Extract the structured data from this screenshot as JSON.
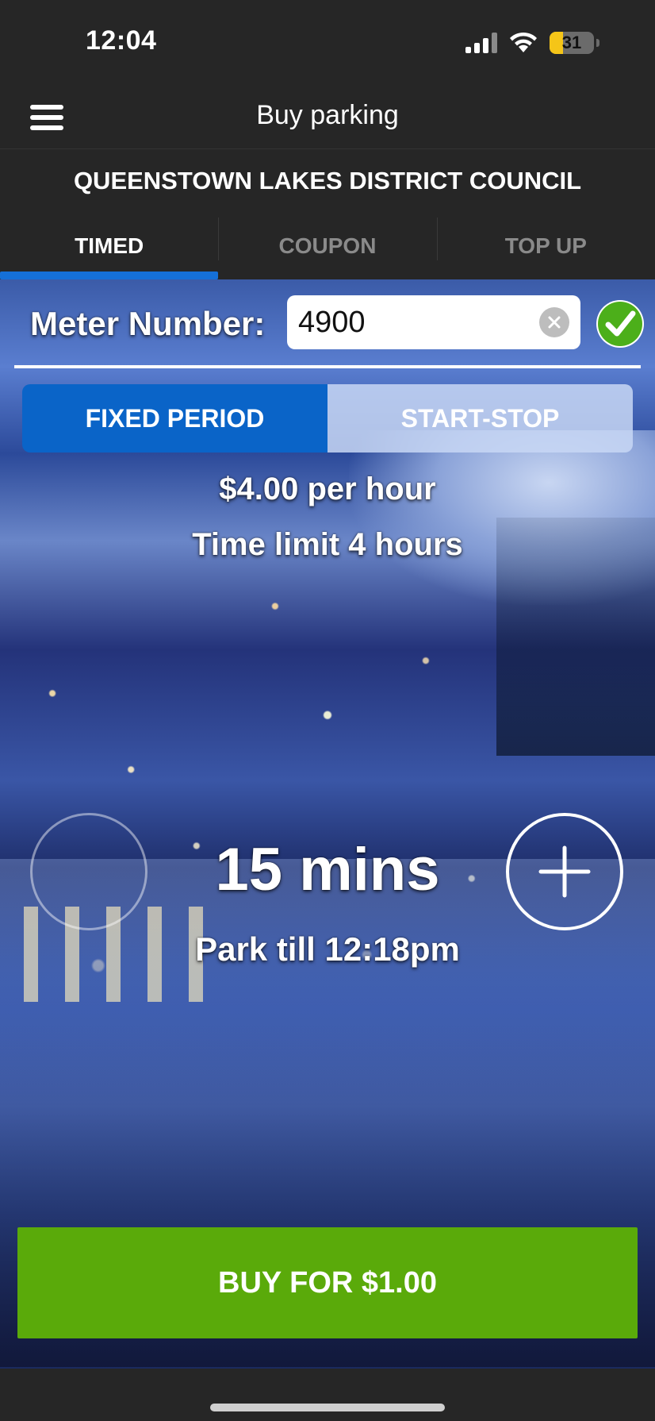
{
  "status_bar": {
    "time": "12:04",
    "battery_level": "31",
    "battery_fraction": 0.31,
    "signal_icon": "cellular-signal-icon",
    "wifi_icon": "wifi-icon"
  },
  "header": {
    "title": "Buy parking",
    "menu_icon": "hamburger-menu-icon"
  },
  "council": "QUEENSTOWN LAKES DISTRICT COUNCIL",
  "tabs": [
    {
      "label": "TIMED",
      "active": true
    },
    {
      "label": "COUPON",
      "active": false
    },
    {
      "label": "TOP UP",
      "active": false
    }
  ],
  "meter": {
    "label": "Meter Number:",
    "value": "4900",
    "clear_icon": "clear-icon",
    "valid_icon": "checkmark-icon"
  },
  "mode": {
    "options": [
      "FIXED PERIOD",
      "START-STOP"
    ],
    "selected": "FIXED PERIOD"
  },
  "rate": "$4.00 per hour",
  "time_limit": "Time limit 4 hours",
  "duration": "15 mins",
  "park_till": "Park till 12:18pm",
  "buy_button": "BUY FOR $1.00",
  "colors": {
    "accent_blue": "#0a64c8",
    "tab_indicator": "#1570d8",
    "buy_green": "#5aaa0a",
    "check_green": "#4caf1a",
    "battery_yellow": "#f5c518",
    "dark_bg": "#262626"
  }
}
